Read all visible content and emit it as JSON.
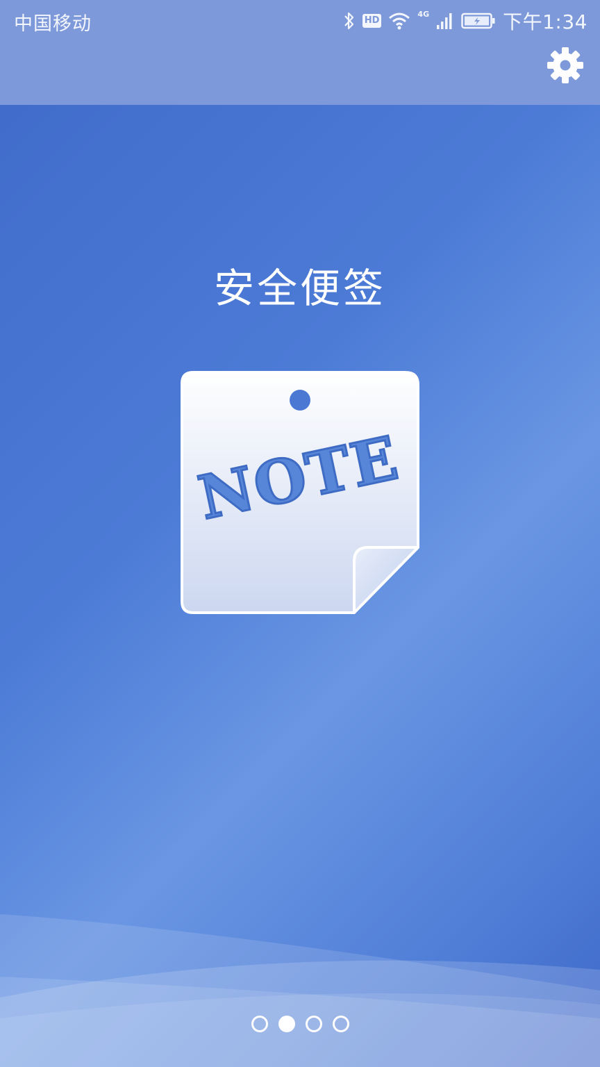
{
  "status_bar": {
    "carrier": "中国移动",
    "hd_badge": "HD",
    "network": "4G",
    "time": "下午1:34"
  },
  "toolbar": {
    "settings_icon": "gear-icon"
  },
  "splash": {
    "title": "安全便签",
    "note_text": "NOTE"
  },
  "pager": {
    "count": 4,
    "active_index": 1
  },
  "colors": {
    "accent": "#4c7bd6",
    "topbar": "#7d99d9",
    "note_text": "#5785d8"
  }
}
